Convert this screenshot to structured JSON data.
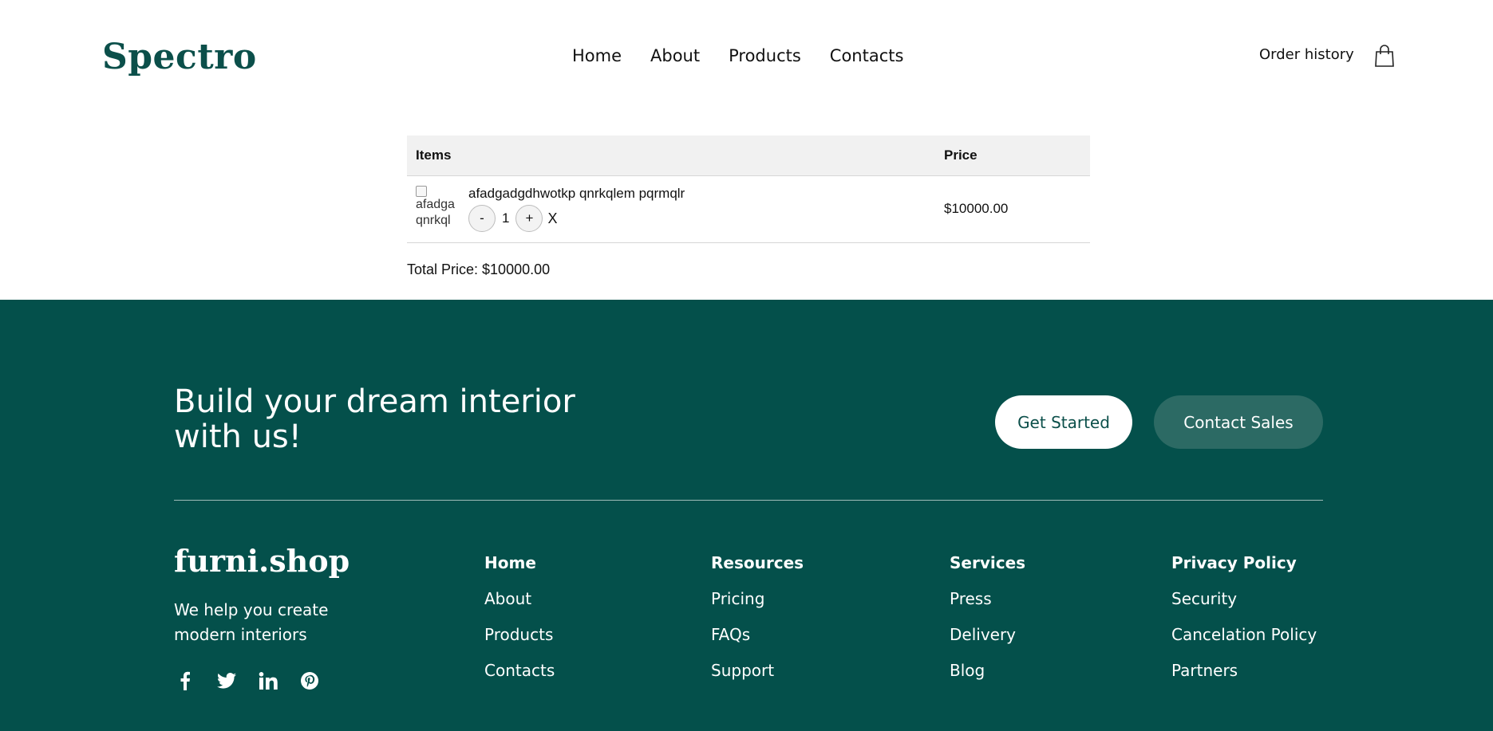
{
  "header": {
    "logo": "Spectro",
    "nav": [
      "Home",
      "About",
      "Products",
      "Contacts"
    ],
    "order_history": "Order history",
    "cart_icon": "shopping-bag-icon"
  },
  "cart": {
    "columns": {
      "items": "Items",
      "price": "Price"
    },
    "items": [
      {
        "image_alt_line1": "afadga",
        "image_alt_line2": "qnrkql",
        "name": "afadgadgdhwotkp qnrkqlem pqrmqlr",
        "qty_minus": "-",
        "quantity": "1",
        "qty_plus": "+",
        "remove": "X",
        "price": "$10000.00"
      }
    ],
    "total": "Total Price: $10000.00"
  },
  "footer": {
    "cta_title": "Build your dream interior with us!",
    "get_started": "Get Started",
    "contact_sales": "Contact Sales",
    "brand": "furni.shop",
    "tagline": "We help you create modern interiors",
    "socials": [
      "facebook-icon",
      "twitter-icon",
      "linkedin-icon",
      "pinterest-icon"
    ],
    "columns": [
      [
        "Home",
        "About",
        "Products",
        "Contacts"
      ],
      [
        "Resources",
        "Pricing",
        "FAQs",
        "Support"
      ],
      [
        "Services",
        "Press",
        "Delivery",
        "Blog"
      ],
      [
        "Privacy Policy",
        "Security",
        "Cancelation Policy",
        "Partners"
      ]
    ]
  },
  "colors": {
    "brand_green": "#04504b",
    "button_secondary": "#2c6a64",
    "table_header": "#f1f1f1"
  }
}
